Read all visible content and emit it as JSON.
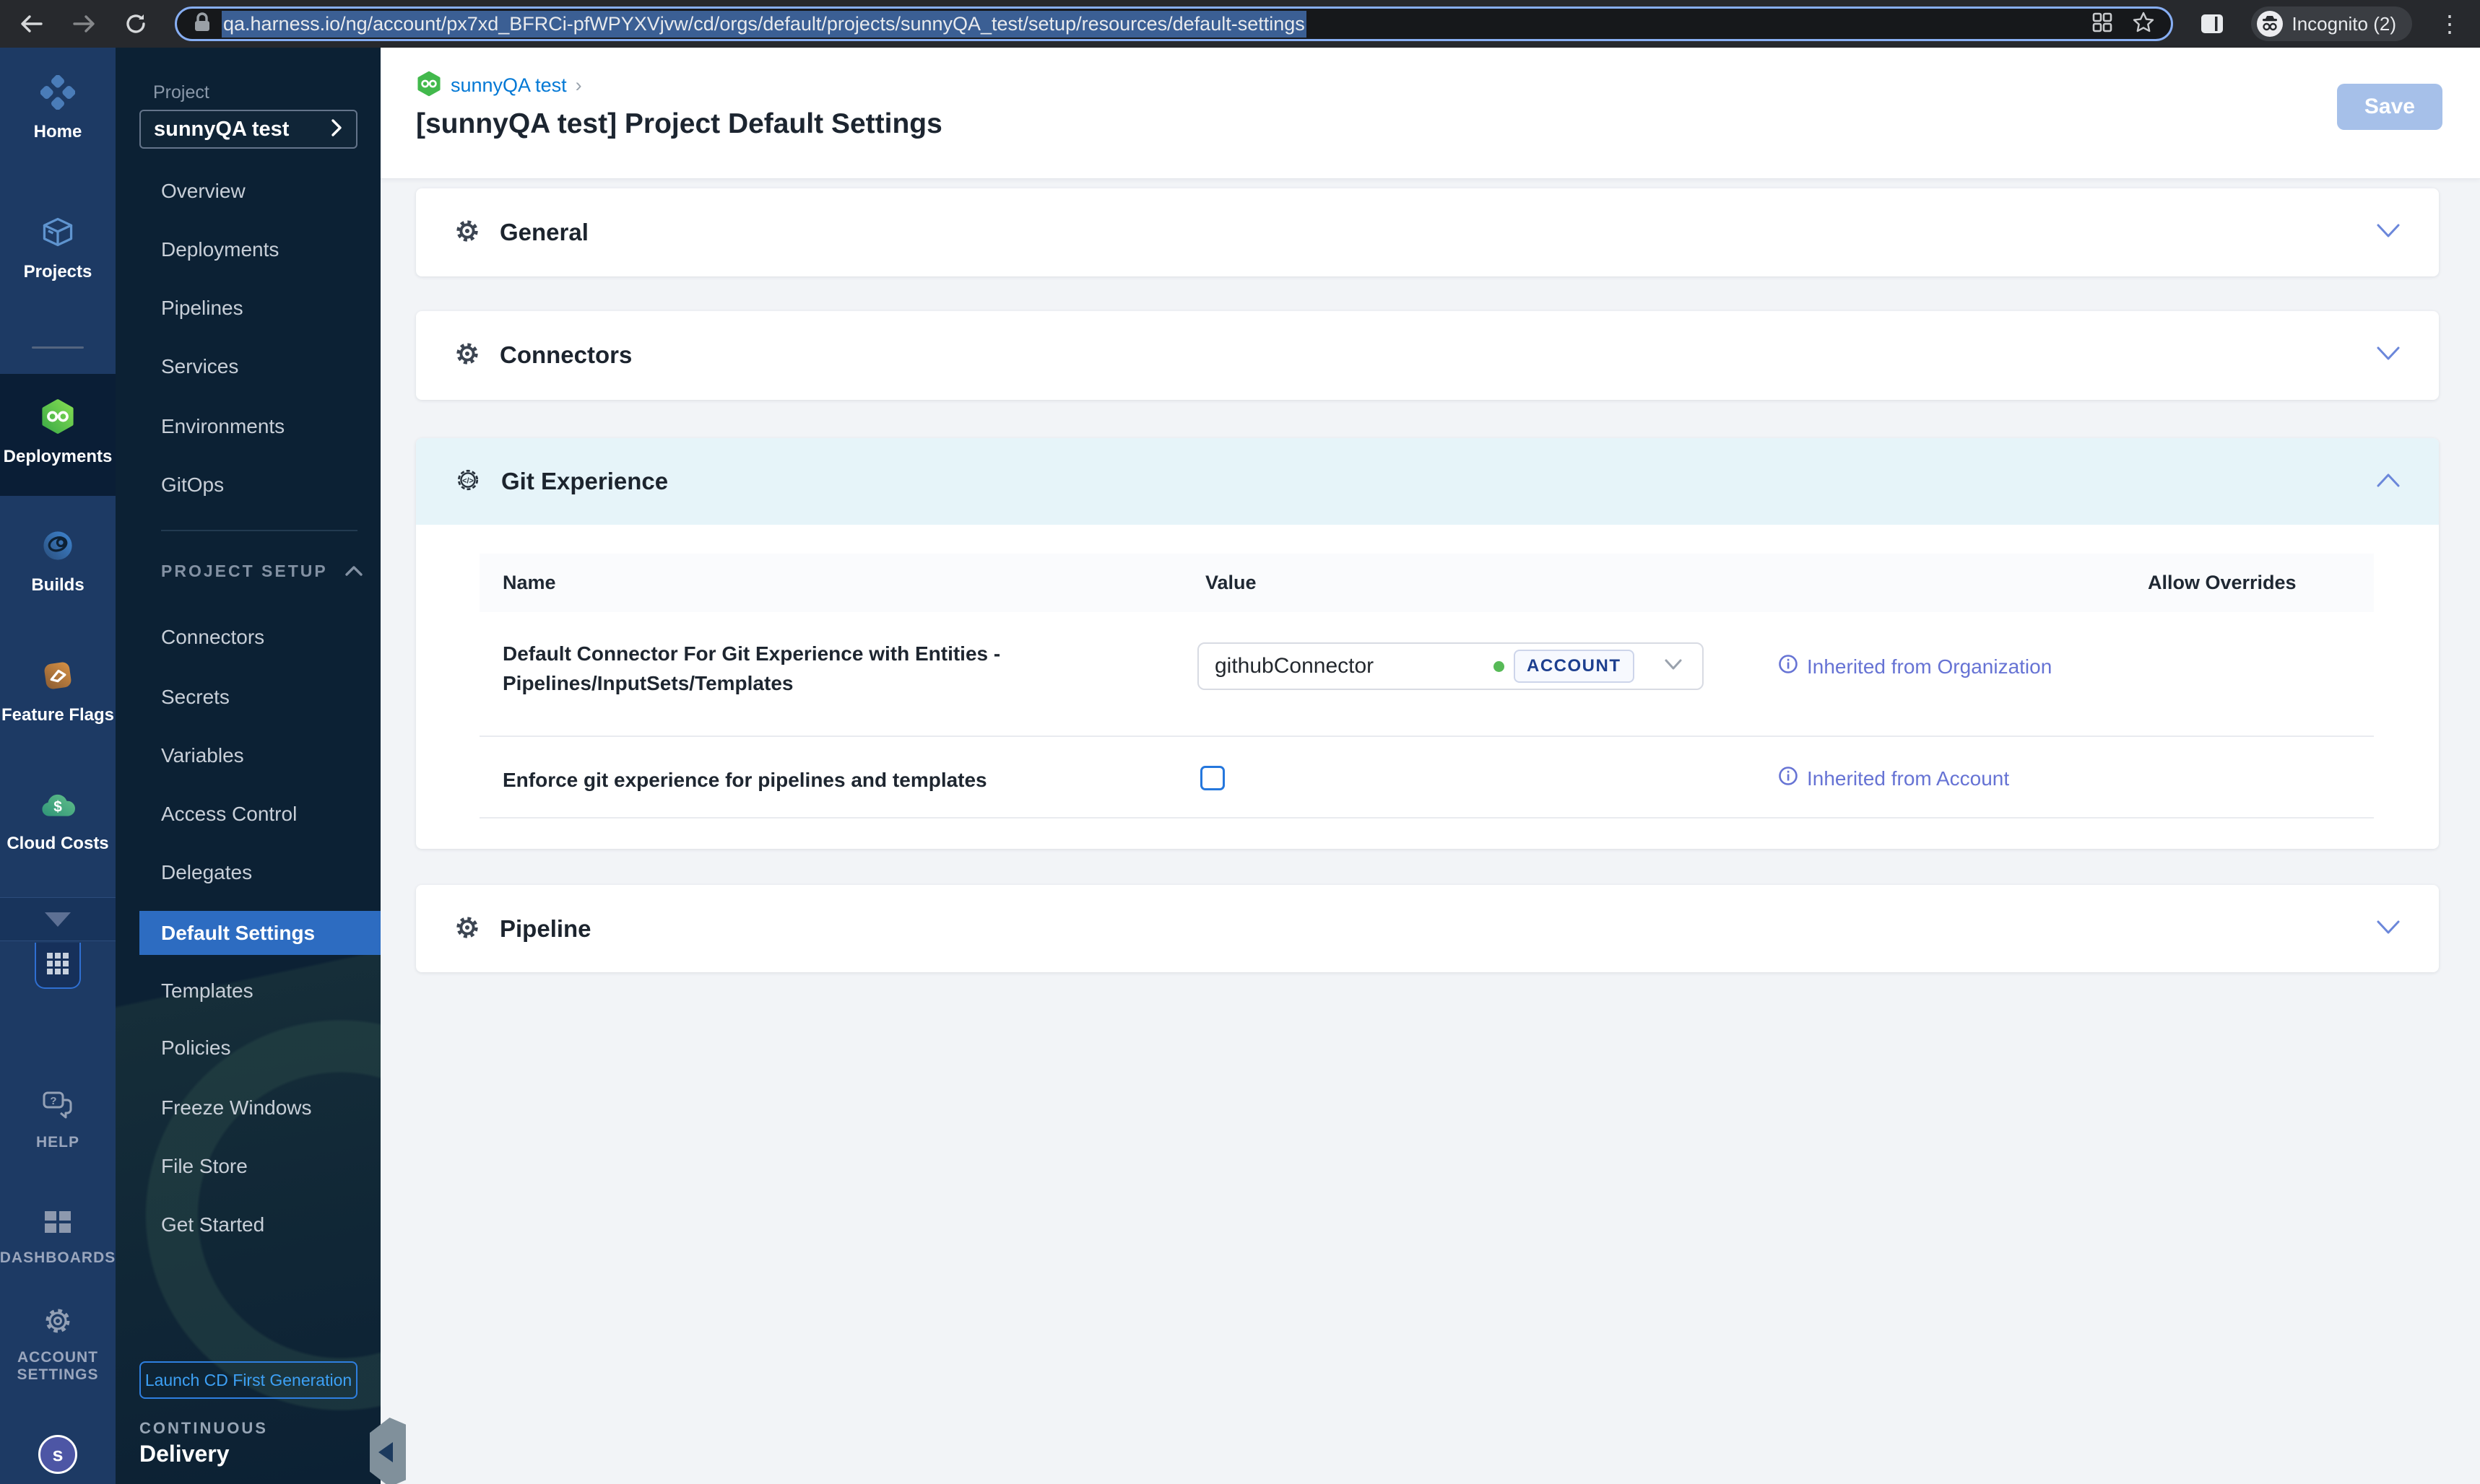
{
  "browser": {
    "url": "qa.harness.io/ng/account/px7xd_BFRCi-pfWPYXVjvw/cd/orgs/default/projects/sunnyQA_test/setup/resources/default-settings",
    "incognito_label": "Incognito (2)"
  },
  "module_nav": {
    "items": [
      {
        "label": "Home"
      },
      {
        "label": "Projects"
      },
      {
        "label": "Deployments",
        "selected": true
      },
      {
        "label": "Builds"
      },
      {
        "label": "Feature Flags"
      },
      {
        "label": "Cloud Costs"
      }
    ],
    "bottom_items": [
      {
        "label": "HELP"
      },
      {
        "label": "DASHBOARDS"
      },
      {
        "label": "ACCOUNT SETTINGS"
      }
    ],
    "avatar_initial": "s"
  },
  "project_nav": {
    "project_label": "Project",
    "project_name": "sunnyQA test",
    "items": [
      "Overview",
      "Deployments",
      "Pipelines",
      "Services",
      "Environments",
      "GitOps"
    ],
    "setup_header": "PROJECT SETUP",
    "setup_items": [
      "Connectors",
      "Secrets",
      "Variables",
      "Access Control",
      "Delegates",
      "Default Settings",
      "Templates",
      "Policies",
      "Freeze Windows",
      "File Store",
      "Get Started"
    ],
    "selected_item": "Default Settings",
    "launch_button": "Launch CD First Generation",
    "footer_top": "CONTINUOUS",
    "footer_bottom": "Delivery"
  },
  "header": {
    "breadcrumb": "sunnyQA test",
    "title": "[sunnyQA test] Project Default Settings",
    "save_button": "Save"
  },
  "sections": {
    "general": {
      "title": "General"
    },
    "connectors": {
      "title": "Connectors"
    },
    "git_experience": {
      "title": "Git Experience",
      "columns": {
        "name": "Name",
        "value": "Value",
        "allow_overrides": "Allow Overrides"
      },
      "rows": [
        {
          "name": "Default Connector For Git Experience with Entities - Pipelines/InputSets/Templates",
          "value": "githubConnector",
          "scope_badge": "ACCOUNT",
          "inherited": "Inherited from Organization"
        },
        {
          "name": "Enforce git experience for pipelines and templates",
          "checkbox_checked": false,
          "inherited": "Inherited from Account"
        }
      ]
    },
    "pipeline": {
      "title": "Pipeline"
    }
  },
  "colors": {
    "accent_blue": "#0278d5",
    "selected_nav_blue": "#2d6cc1",
    "inherit_link_purple": "#6673d4",
    "git_header_cyan": "#e6f4f9",
    "save_disabled_blue": "#a6c0e9",
    "status_green": "#57ba57"
  }
}
